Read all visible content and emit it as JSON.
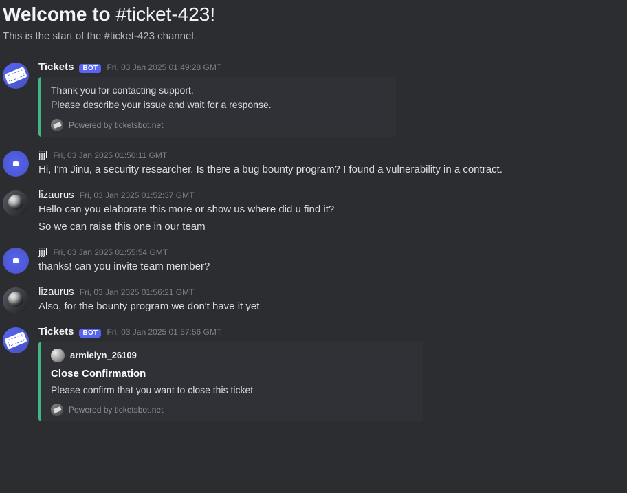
{
  "welcome": {
    "title_prefix": "Welcome to ",
    "channel": "#ticket-423!",
    "subtitle": "This is the start of the #ticket-423 channel."
  },
  "bot_tag": "BOT",
  "powered_by": "Powered by ticketsbot.net",
  "messages": [
    {
      "user": "Tickets",
      "is_bot": true,
      "avatar": "tickets",
      "time": "Fri, 03 Jan 2025 01:49:28 GMT",
      "embed": {
        "lines": [
          "Thank you for contacting support.",
          "Please describe your issue and wait for a response."
        ]
      }
    },
    {
      "user": "jjjl",
      "avatar": "jjjl",
      "time": "Fri, 03 Jan 2025 01:50:11 GMT",
      "text": "Hi, I'm Jinu, a security researcher. Is there a bug bounty program? I found a vulnerability in a contract."
    },
    {
      "user": "lizaurus",
      "avatar": "liz",
      "time": "Fri, 03 Jan 2025 01:52:37 GMT",
      "lines": [
        "Hello can you elaborate this more or show us where did u find it?",
        "So we can raise this one in our team"
      ]
    },
    {
      "user": "jjjl",
      "avatar": "jjjl",
      "time": "Fri, 03 Jan 2025 01:55:54 GMT",
      "text": "thanks! can you invite team member?"
    },
    {
      "user": "lizaurus",
      "avatar": "liz",
      "time": "Fri, 03 Jan 2025 01:56:21 GMT",
      "text": "Also, for the bounty program we don't have it yet"
    },
    {
      "user": "Tickets",
      "is_bot": true,
      "avatar": "tickets",
      "time": "Fri, 03 Jan 2025 01:57:56 GMT",
      "embed": {
        "author": "armielyn_26109",
        "title": "Close Confirmation",
        "desc": "Please confirm that you want to close this ticket"
      }
    }
  ]
}
